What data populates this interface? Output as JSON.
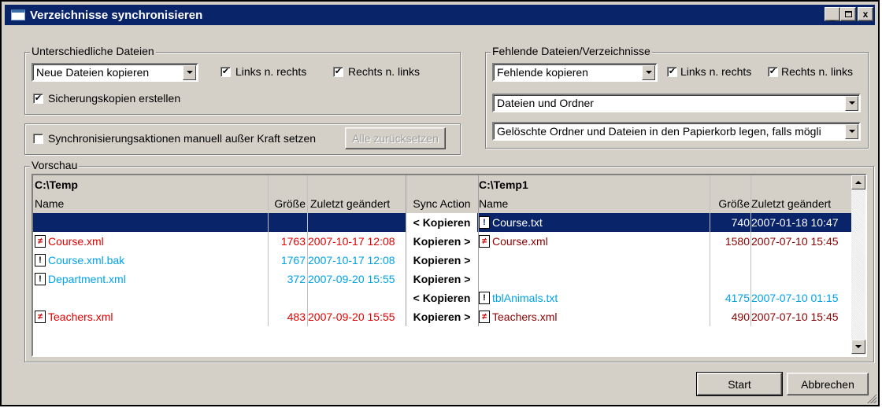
{
  "window": {
    "title": "Verzeichnisse synchronisieren",
    "buttons": [
      "_",
      "□",
      "x"
    ]
  },
  "diff_group": {
    "legend": "Unterschiedliche Dateien",
    "mode_value": "Neue Dateien kopieren",
    "left_to_right": {
      "label": "Links n. rechts",
      "checked": true
    },
    "right_to_left": {
      "label": "Rechts n. links",
      "checked": true
    },
    "backup": {
      "label": "Sicherungskopien erstellen",
      "checked": true
    }
  },
  "override": {
    "label": "Synchronisierungsaktionen manuell außer Kraft setzen",
    "checked": false,
    "reset_button": "Alle zurücksetzen"
  },
  "missing_group": {
    "legend": "Fehlende Dateien/Verzeichnisse",
    "mode_value": "Fehlende kopieren",
    "left_to_right": {
      "label": "Links n. rechts",
      "checked": true
    },
    "right_to_left": {
      "label": "Rechts n. links",
      "checked": true
    },
    "type_value": "Dateien und Ordner",
    "delete_value": "Gelöschte Ordner und Dateien in den Papierkorb legen, falls mögli"
  },
  "preview": {
    "legend": "Vorschau",
    "left_dir": "C:\\Temp",
    "right_dir": "C:\\Temp1",
    "col_name": "Name",
    "col_size": "Größe",
    "col_modified": "Zuletzt geändert",
    "col_action": "Sync Action",
    "rows": [
      {
        "l_name": "",
        "l_size": "",
        "l_date": "",
        "action": "< Kopieren",
        "r_name": "Course.txt",
        "r_size": "740",
        "r_date": "2007-01-18 10:47"
      },
      {
        "l_name": "Course.xml",
        "l_size": "1763",
        "l_date": "2007-10-17 12:08",
        "action": "Kopieren >",
        "r_name": "Course.xml",
        "r_size": "1580",
        "r_date": "2007-07-10 15:45"
      },
      {
        "l_name": "Course.xml.bak",
        "l_size": "1767",
        "l_date": "2007-10-17 12:08",
        "action": "Kopieren >",
        "r_name": "",
        "r_size": "",
        "r_date": ""
      },
      {
        "l_name": "Department.xml",
        "l_size": "372",
        "l_date": "2007-09-20 15:55",
        "action": "Kopieren >",
        "r_name": "",
        "r_size": "",
        "r_date": ""
      },
      {
        "l_name": "",
        "l_size": "",
        "l_date": "",
        "action": "< Kopieren",
        "r_name": "tblAnimals.txt",
        "r_size": "4175",
        "r_date": "2007-07-10 01:15"
      },
      {
        "l_name": "Teachers.xml",
        "l_size": "483",
        "l_date": "2007-09-20 15:55",
        "action": "Kopieren >",
        "r_name": "Teachers.xml",
        "r_size": "490",
        "r_date": "2007-07-10 15:45"
      }
    ]
  },
  "footer": {
    "start": "Start",
    "cancel": "Abbrechen"
  },
  "colors": {
    "title_bar": "#0a246a",
    "differs_red": "#e00000",
    "missing_blue": "#00a2e8",
    "selection": "#0a246a"
  },
  "icons": {
    "differs": "not-equal-file-icon",
    "missing": "exclamation-file-icon"
  }
}
